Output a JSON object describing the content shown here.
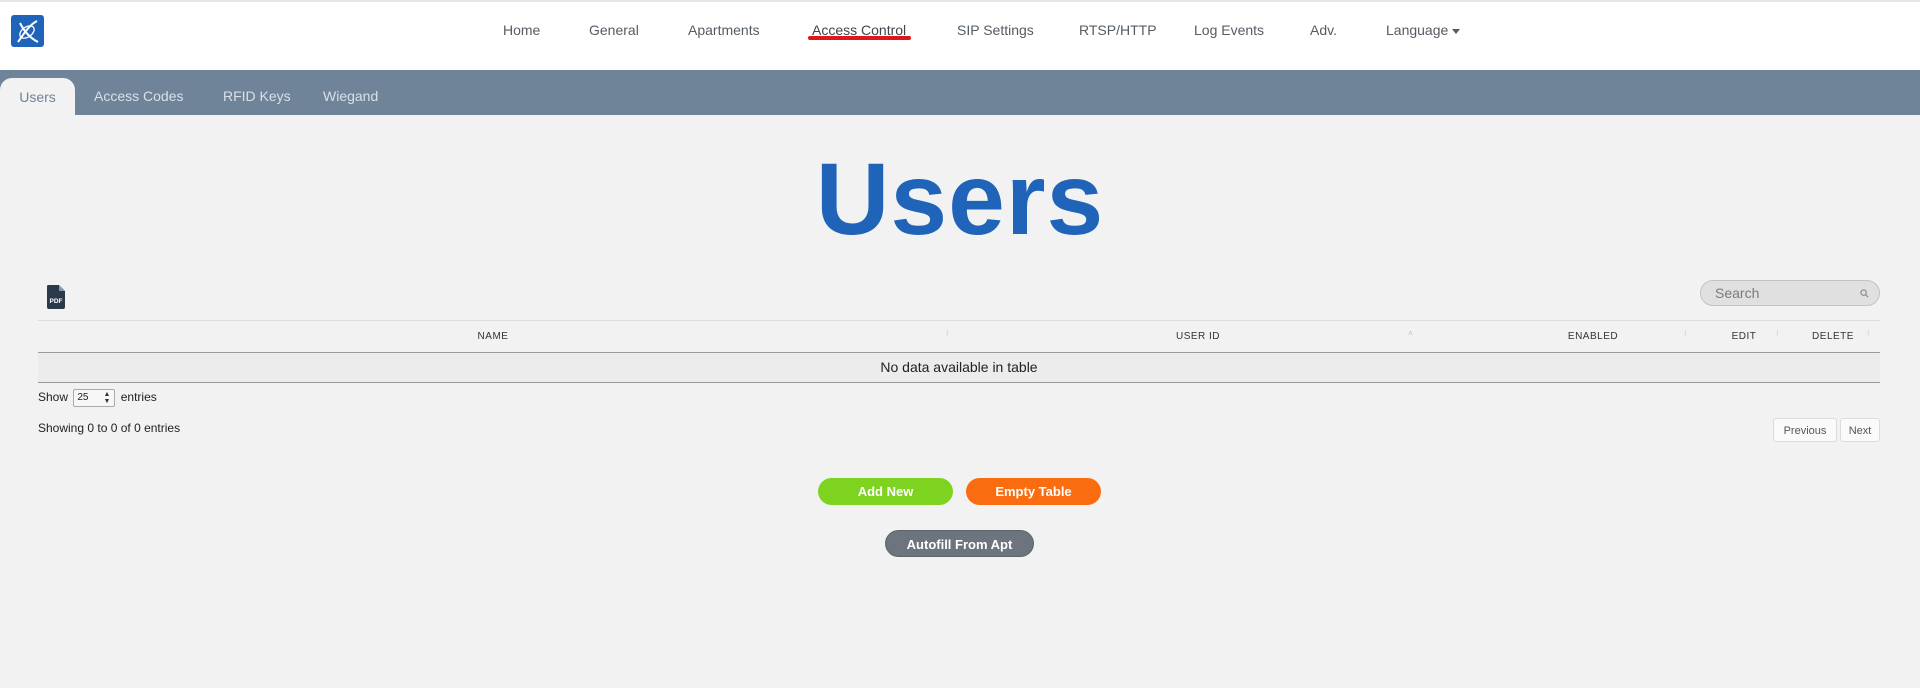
{
  "nav": {
    "items": [
      {
        "label": "Home"
      },
      {
        "label": "General"
      },
      {
        "label": "Apartments"
      },
      {
        "label": "Access Control"
      },
      {
        "label": "SIP Settings"
      },
      {
        "label": "RTSP/HTTP"
      },
      {
        "label": "Log Events"
      },
      {
        "label": "Adv."
      },
      {
        "label": "Language"
      }
    ],
    "active": "Access Control"
  },
  "subtabs": [
    {
      "label": "Users"
    },
    {
      "label": "Access Codes"
    },
    {
      "label": "RFID Keys"
    },
    {
      "label": "Wiegand"
    }
  ],
  "page": {
    "title": "Users"
  },
  "search": {
    "placeholder": "Search"
  },
  "table": {
    "columns": [
      "NAME",
      "USER ID",
      "ENABLED",
      "EDIT",
      "DELETE"
    ],
    "empty_message": "No data available in table",
    "length": {
      "prefix": "Show",
      "value": "25",
      "suffix": "entries"
    },
    "info": "Showing 0 to 0 of 0 entries",
    "pager": {
      "previous": "Previous",
      "next": "Next"
    }
  },
  "actions": {
    "add_new": "Add New",
    "empty_table": "Empty Table",
    "autofill": "Autofill From Apt"
  },
  "colors": {
    "brand": "#1f64b8",
    "subbar": "#6f8498",
    "add": "#7ed321",
    "empty": "#f96d10",
    "autofill": "#6c757d",
    "nav_highlight": "#e0161b"
  }
}
